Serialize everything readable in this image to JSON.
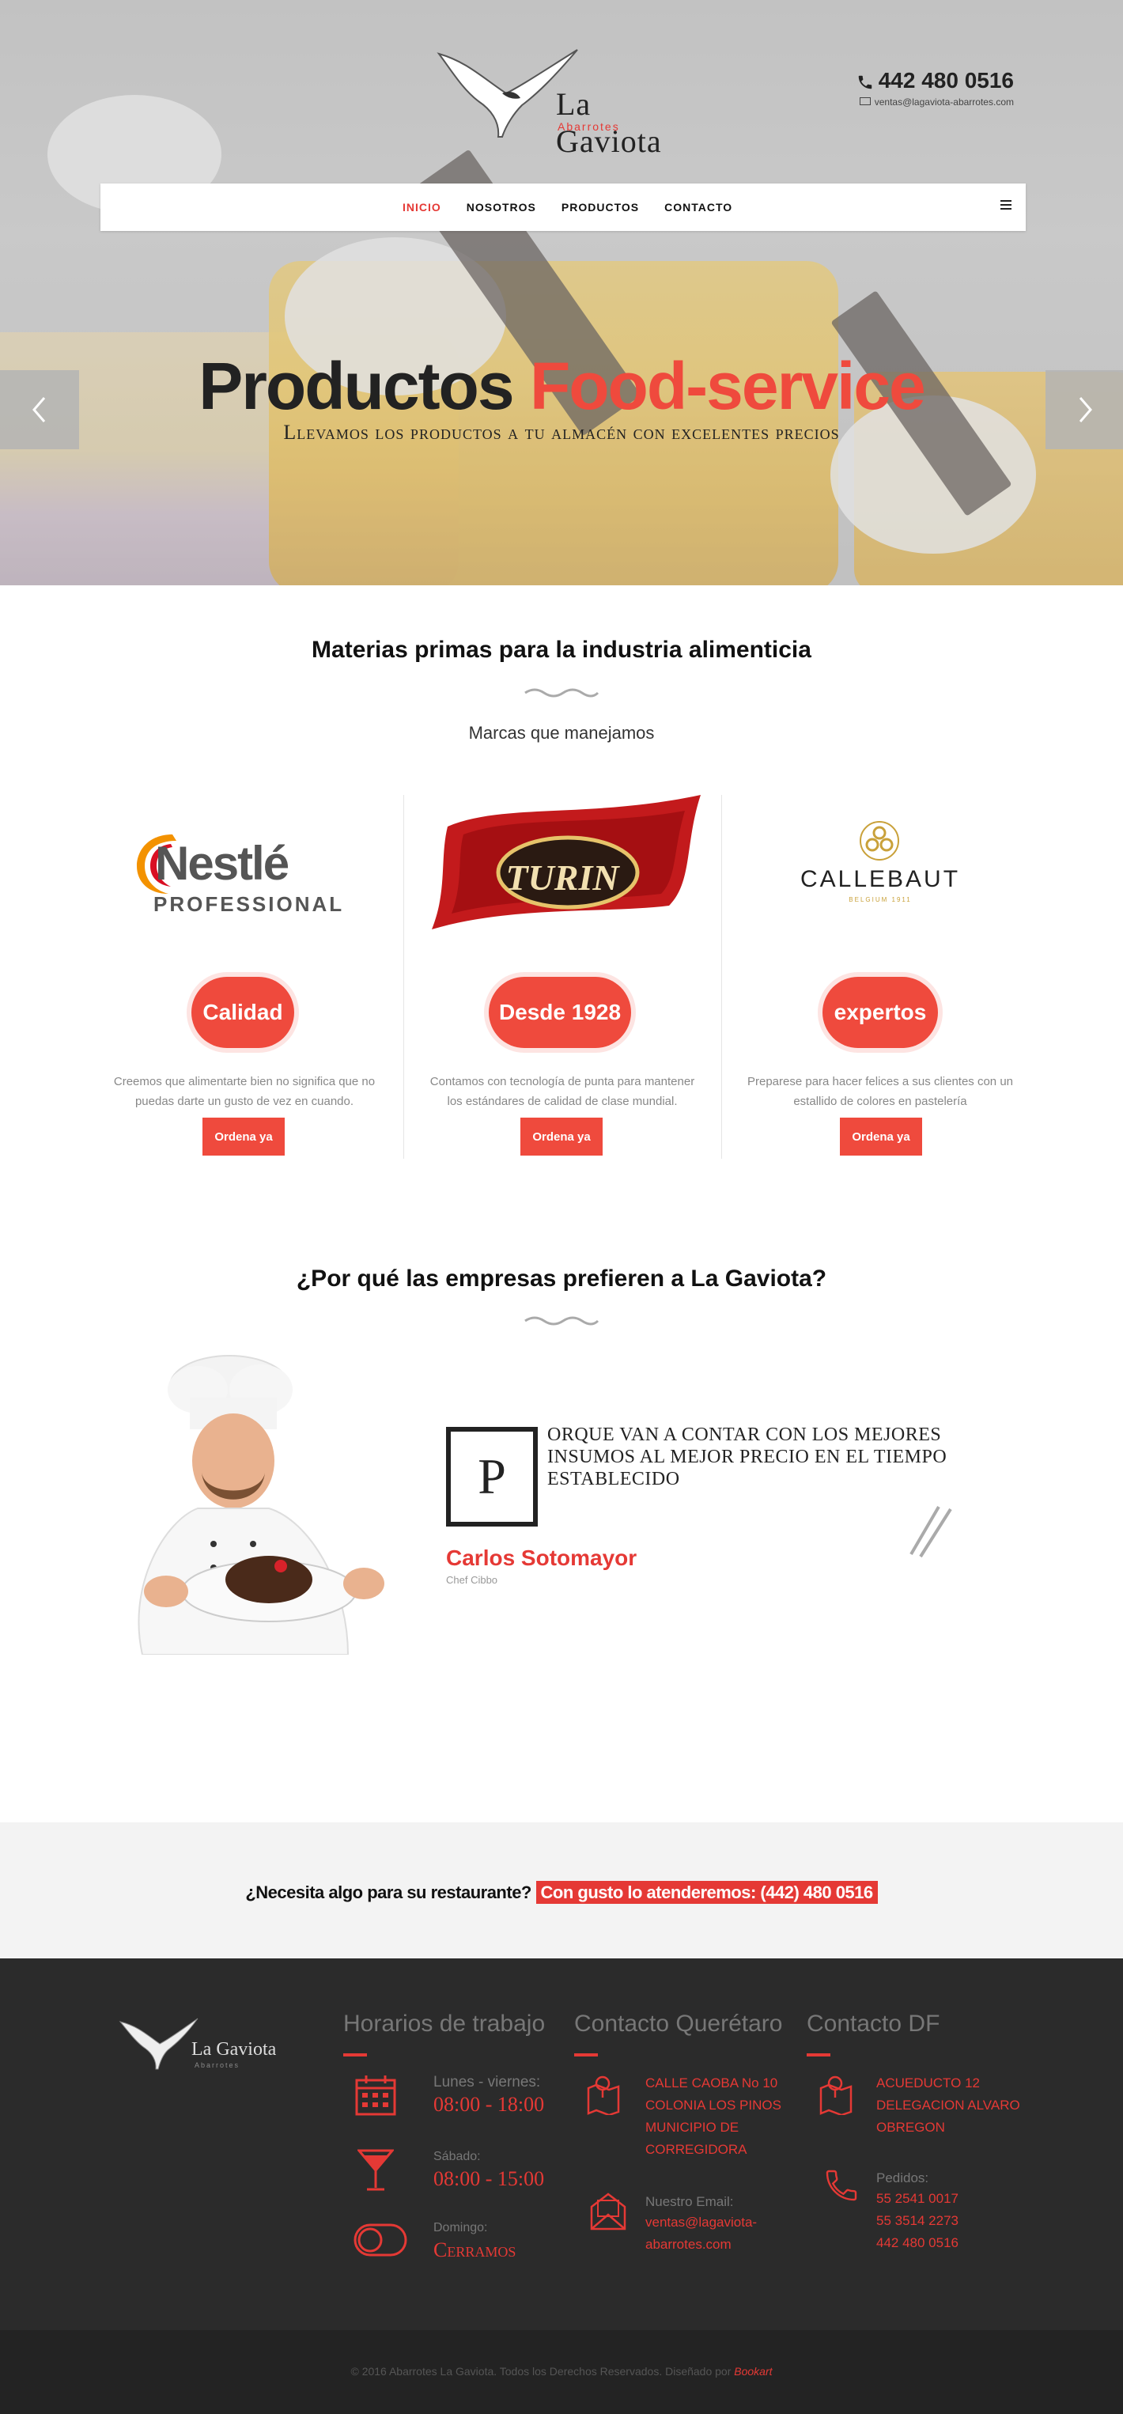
{
  "header": {
    "logo_title": "La Gaviota",
    "logo_subtitle": "Abarrotes",
    "phone": "442 480 0516",
    "email": "ventas@lagaviota-abarrotes.com",
    "phone_icon": "phone-icon",
    "email_icon": "envelope-icon"
  },
  "nav": {
    "items": [
      {
        "label": "INICIO",
        "active": true
      },
      {
        "label": "NOSOTROS",
        "active": false
      },
      {
        "label": "PRODUCTOS",
        "active": false
      },
      {
        "label": "CONTACTO",
        "active": false
      }
    ],
    "menu_icon": "hamburger-icon"
  },
  "hero": {
    "title_part1": "Productos",
    "title_part2": "Food-service",
    "subtitle": "Llevamos los productos a tu almacén con excelentes precios",
    "prev_icon": "chevron-left-icon",
    "next_icon": "chevron-right-icon"
  },
  "brands": {
    "title": "Materias primas para la industria alimenticia",
    "subtitle": "Marcas que manejamos",
    "items": [
      {
        "logo_main": "Nestlé",
        "logo_sub": "PROFESSIONAL",
        "badge": "Calidad",
        "text_line1": "Creemos que alimentarte bien no significa que no",
        "text_line2": "puedas darte un gusto de vez en cuando.",
        "button": "Ordena ya"
      },
      {
        "logo_main": "TURIN",
        "logo_sub": "",
        "badge": "Desde 1928",
        "text_line1": "Contamos con tecnología de punta para mantener",
        "text_line2": "los estándares de calidad de clase mundial.",
        "button": "Ordena ya"
      },
      {
        "logo_main": "CALLEBAUT",
        "logo_sub": "BELGIUM 1911",
        "badge": "expertos",
        "text_line1": "Preparese para hacer felices a sus clientes con un",
        "text_line2": "estallido de colores en pastelería",
        "button": "Ordena ya"
      }
    ]
  },
  "why": {
    "title": "¿Por qué las empresas prefieren a La Gaviota?",
    "dropcap": "P",
    "quote": "orque van a contar con los mejores insumos al mejor precio en el tiempo establecido",
    "author": "Carlos Sotomayor",
    "role": "Chef Cibbo",
    "quote_icon": "quote-slash-icon"
  },
  "cta": {
    "question": "¿Necesita algo para su restaurante?",
    "highlight": "Con gusto lo atenderemos: (442) 480 0516"
  },
  "footer": {
    "logo_title": "La Gaviota",
    "logo_subtitle": "Abarrotes",
    "hours": {
      "title": "Horarios de trabajo",
      "weekday_label": "Lunes - viernes:",
      "weekday_time": "08:00 - 18:00",
      "saturday_label": "Sábado:",
      "saturday_time": "08:00 - 15:00",
      "sunday_label": "Domingo:",
      "sunday_time": "Cerramos"
    },
    "queretaro": {
      "title": "Contacto Querétaro",
      "address": [
        "CALLE CAOBA No 10",
        "COLONIA LOS PINOS",
        "MUNICIPIO DE",
        "CORREGIDORA"
      ],
      "email_label": "Nuestro Email:",
      "email": [
        "ventas@lagaviota-",
        "abarrotes.com"
      ]
    },
    "df": {
      "title": "Contacto DF",
      "address": [
        "ACUEDUCTO 12",
        "DELEGACION ALVARO",
        "OBREGON"
      ],
      "phones_label": "Pedidos:",
      "phones": [
        "55 2541 0017",
        "55 3514 2273",
        "442 480 0516"
      ]
    },
    "copyright": "© 2016 Abarrotes La Gaviota. Todos los Derechos Reservados. Diseñado por",
    "designer": "Bookart"
  },
  "colors": {
    "accent": "#ef4a3d",
    "dark": "#2b2b2b"
  }
}
